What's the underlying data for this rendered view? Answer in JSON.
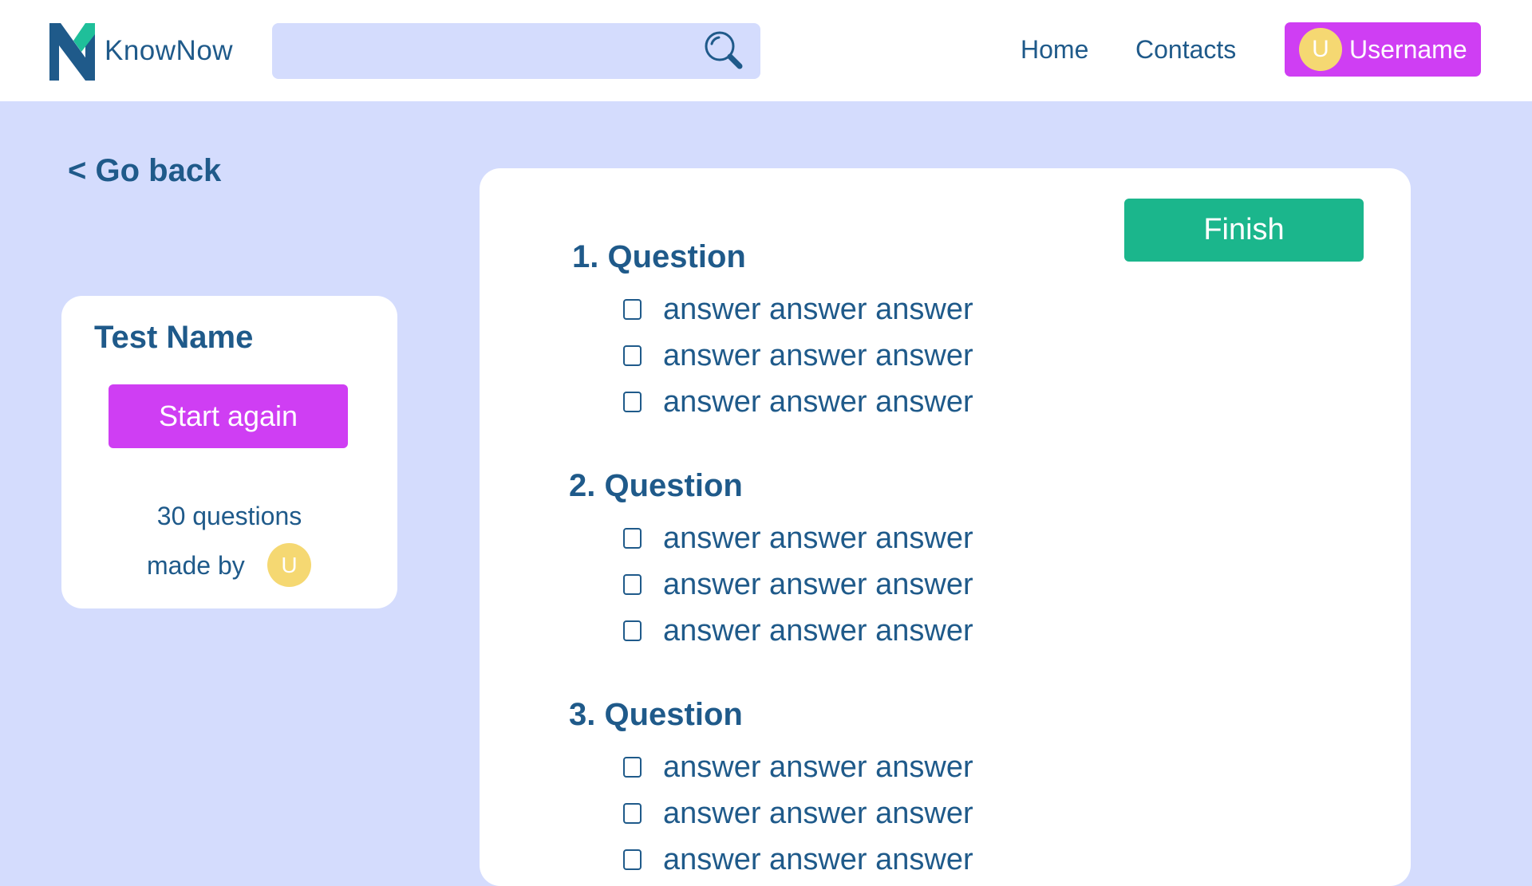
{
  "header": {
    "brand": "KnowNow",
    "search": {
      "value": "",
      "placeholder": ""
    },
    "nav": {
      "home": "Home",
      "contacts": "Contacts"
    },
    "user": {
      "initial": "U",
      "name": "Username"
    }
  },
  "go_back": "< Go back",
  "test_card": {
    "title": "Test Name",
    "start_again": "Start again",
    "question_count": "30 questions",
    "made_by": "made by",
    "author_initial": "U"
  },
  "quiz": {
    "finish": "Finish",
    "questions": [
      {
        "title": "1. Question",
        "answers": [
          "answer answer answer",
          "answer answer answer",
          "answer answer answer"
        ]
      },
      {
        "title": "2. Question",
        "answers": [
          "answer answer answer",
          "answer answer answer",
          "answer answer answer"
        ]
      },
      {
        "title": "3. Question",
        "answers": [
          "answer answer answer",
          "answer answer answer",
          "answer answer answer"
        ]
      }
    ]
  },
  "colors": {
    "background": "#d4dcfd",
    "primary_text": "#1f5a8a",
    "accent_purple": "#cf3ef3",
    "accent_green": "#1bb68c",
    "avatar_yellow": "#f5d872",
    "logo_teal": "#1fbf9a"
  },
  "icons": {
    "logo": "knownow-n-logo",
    "search": "search-icon"
  }
}
